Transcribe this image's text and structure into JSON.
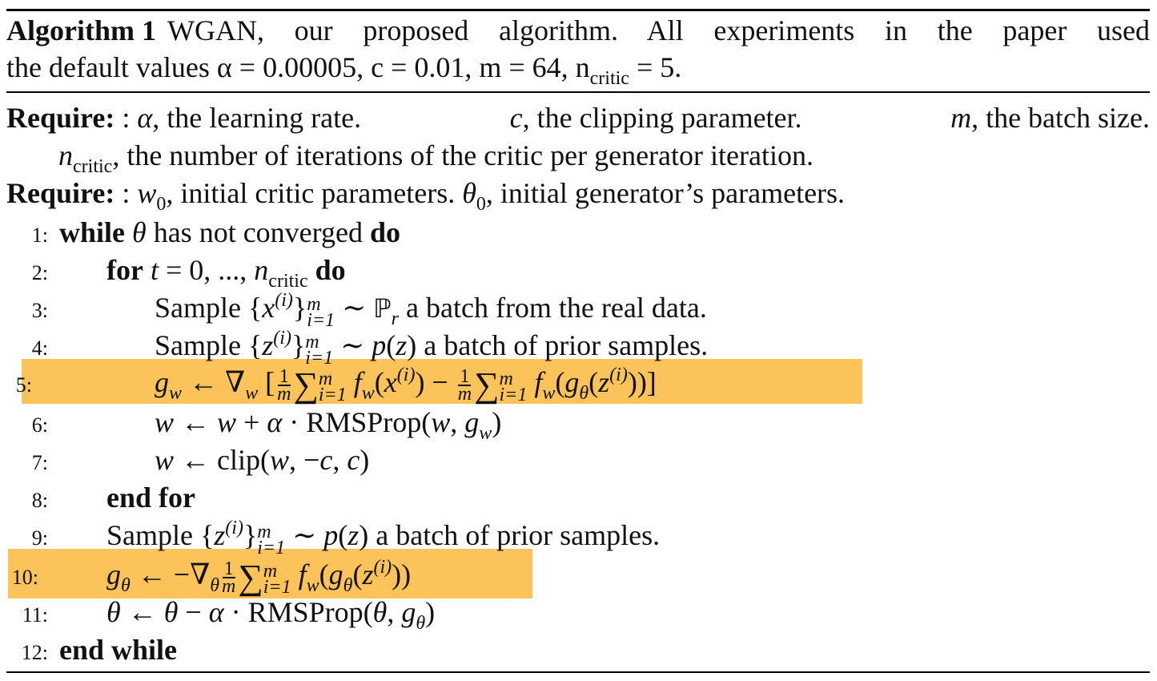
{
  "caption": {
    "label": "Algorithm 1",
    "text_l1": "WGAN, our proposed algorithm. All experiments in the paper used",
    "text_l2a": "the default values α = 0.00005, c = 0.01, m = 64, n",
    "text_l2_sub": "critic",
    "text_l2b": " = 5."
  },
  "require": {
    "keyword": "Require:",
    "r1": {
      "a": ": ",
      "alpha": "α",
      "b": ", the learning rate.",
      "c": "c",
      "d": ", the clipping parameter.",
      "m": "m",
      "e": ", the batch size."
    },
    "r2": {
      "n": "n",
      "sub": "critic",
      "text": ", the number of iterations of the critic per generator iteration."
    },
    "r3": {
      "a": ": ",
      "w": "w",
      "w_sub": "0",
      "b": ", initial critic parameters. ",
      "theta": "θ",
      "theta_sub": "0",
      "c": ", initial generator’s parameters."
    }
  },
  "lines": [
    {
      "num": "1:"
    },
    {
      "num": "2:"
    },
    {
      "num": "3:"
    },
    {
      "num": "4:"
    },
    {
      "num": "5:"
    },
    {
      "num": "6:"
    },
    {
      "num": "7:"
    },
    {
      "num": "8:"
    },
    {
      "num": "9:"
    },
    {
      "num": "10:"
    },
    {
      "num": "11:"
    },
    {
      "num": "12:"
    }
  ],
  "code": {
    "l1": {
      "kw1": "while",
      "var": "θ",
      "text": " has not converged ",
      "kw2": "do"
    },
    "l2": {
      "kw1": "for",
      "expr": "t",
      "mid": " = 0, ..., ",
      "n": "n",
      "sub": "critic",
      "kw2": "do"
    },
    "l3": {
      "a": "Sample {",
      "x": "x",
      "sup": "(i)",
      "b": "}",
      "top": "m",
      "bot": "i=1",
      "c": " ∼ ",
      "P": "ℙ",
      "Psub": "r",
      "d": " a batch from the real data."
    },
    "l4": {
      "a": "Sample {",
      "z": "z",
      "sup": "(i)",
      "b": "}",
      "top": "m",
      "bot": "i=1",
      "c": " ∼ ",
      "p": "p",
      "d": "(",
      "zz": "z",
      "e": ") a batch of prior samples."
    },
    "l5": {
      "g": "g",
      "gsub": "w",
      "arrow": " ← ∇",
      "nsub": "w",
      "lb": " [",
      "one": "1",
      "m": "m",
      "sum": "∑",
      "top": "m",
      "bot": "i=1",
      "f": "f",
      "fsub": "w",
      "p1": "(",
      "x": "x",
      "sup": "(i)",
      "p2": ") − ",
      "one2": "1",
      "m2": "m",
      "sum2": "∑",
      "top2": "m",
      "bot2": "i=1",
      "f2": "f",
      "fsub2": "w",
      "p3": "(",
      "g2": "g",
      "gsub2": "θ",
      "p4": "(",
      "z": "z",
      "sup2": "(i)",
      "p5": "))]"
    },
    "l6": {
      "w": "w",
      "a": " ← ",
      "w2": "w",
      "b": " + ",
      "alpha": "α",
      "c": " · RMSProp(",
      "w3": "w",
      "d": ", ",
      "g": "g",
      "gsub": "w",
      "e": ")"
    },
    "l7": {
      "w": "w",
      "a": " ← clip(",
      "w2": "w",
      "b": ", −",
      "c": "c",
      "d": ", ",
      "c2": "c",
      "e": ")"
    },
    "l8": {
      "kw": "end for"
    },
    "l9": {
      "a": "Sample {",
      "z": "z",
      "sup": "(i)",
      "b": "}",
      "top": "m",
      "bot": "i=1",
      "c": " ∼ ",
      "p": "p",
      "d": "(",
      "zz": "z",
      "e": ") a batch of prior samples."
    },
    "l10": {
      "g": "g",
      "gsub": "θ",
      "arrow": " ← −∇",
      "nsub": "θ",
      "one": "1",
      "m": "m",
      "sum": "∑",
      "top": "m",
      "bot": "i=1",
      "f": "f",
      "fsub": "w",
      "p1": "(",
      "g2": "g",
      "gsub2": "θ",
      "p2": "(",
      "z": "z",
      "sup": "(i)",
      "p3": "))"
    },
    "l11": {
      "t": "θ",
      "a": " ← ",
      "t2": "θ",
      "b": " − ",
      "alpha": "α",
      "c": " · RMSProp(",
      "t3": "θ",
      "d": ", ",
      "g": "g",
      "gsub": "θ",
      "e": ")"
    },
    "l12": {
      "kw": "end while"
    }
  },
  "colors": {
    "highlight": "#fbc35a",
    "rule": "#000000"
  }
}
